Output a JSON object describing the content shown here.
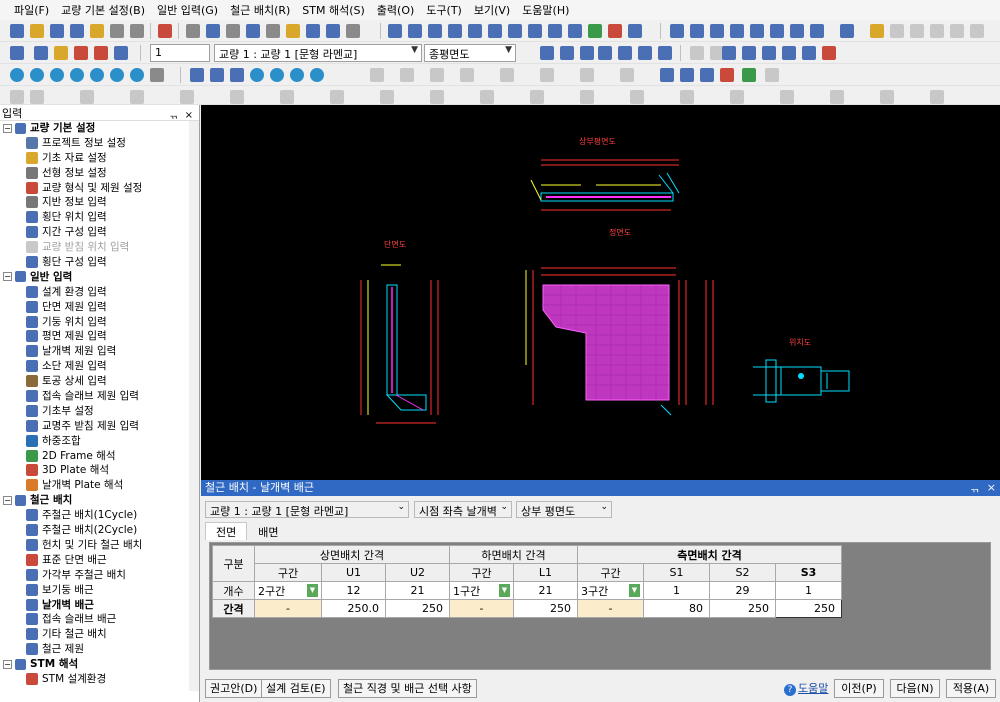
{
  "menu": [
    "파일(F)",
    "교량 기본 설정(B)",
    "일반 입력(G)",
    "철근 배치(R)",
    "STM 해석(S)",
    "출력(O)",
    "도구(T)",
    "보기(V)",
    "도움말(H)"
  ],
  "toolbar": {
    "number_field": "1",
    "bridge_combo": "교량 1 : 교량 1 [문형 라멘교]",
    "view_combo": "종평면도"
  },
  "panel": {
    "title": "입력",
    "pin": "ᆩ",
    "close": "×",
    "groups": [
      {
        "label": "교량 기본 설정",
        "items": [
          {
            "label": "프로젝트 정보 설정",
            "icon": "#5577aa"
          },
          {
            "label": "기초 자료 설정",
            "icon": "#d9a82b"
          },
          {
            "label": "선형 정보 설정",
            "icon": "#777777"
          },
          {
            "label": "교량 형식 및 제원 설정",
            "icon": "#c94a3a"
          },
          {
            "label": "지반 정보 입력",
            "icon": "#777777"
          },
          {
            "label": "횡단 위치 입력",
            "icon": "#4a6fb5"
          },
          {
            "label": "지간 구성 입력",
            "icon": "#4a6fb5"
          },
          {
            "label": "교량 받침 위치 입력",
            "icon": "#c8c8c8",
            "disabled": true
          },
          {
            "label": "횡단 구성 입력",
            "icon": "#4a6fb5"
          }
        ]
      },
      {
        "label": "일반 입력",
        "items": [
          {
            "label": "설계 환경 입력",
            "icon": "#4a6fb5"
          },
          {
            "label": "단면 제원 입력",
            "icon": "#4a6fb5"
          },
          {
            "label": "기둥 위치 입력",
            "icon": "#4a6fb5"
          },
          {
            "label": "평면 제원 입력",
            "icon": "#4a6fb5"
          },
          {
            "label": "날개벽 제원 입력",
            "icon": "#4a6fb5"
          },
          {
            "label": "소단 제원 입력",
            "icon": "#4a6fb5"
          },
          {
            "label": "토공 상세 입력",
            "icon": "#8a6a3a"
          },
          {
            "label": "접속 슬래브 제원 입력",
            "icon": "#4a6fb5"
          },
          {
            "label": "기초부 설정",
            "icon": "#4a6fb5"
          },
          {
            "label": "교명주 받침 제원 입력",
            "icon": "#4a6fb5"
          },
          {
            "label": "하중조합",
            "icon": "#2b6fb5"
          },
          {
            "label": "2D Frame 해석",
            "icon": "#3a9a4a"
          },
          {
            "label": "3D Plate 해석",
            "icon": "#c94a3a"
          },
          {
            "label": "날개벽 Plate 해석",
            "icon": "#d97a2b"
          }
        ]
      },
      {
        "label": "철근 배치",
        "items": [
          {
            "label": "주철근 배치(1Cycle)",
            "icon": "#4a6fb5"
          },
          {
            "label": "주철근 배치(2Cycle)",
            "icon": "#4a6fb5"
          },
          {
            "label": "헌치 및 기타 철근 배치",
            "icon": "#4a6fb5"
          },
          {
            "label": "표준 단면 배근",
            "icon": "#c94a3a"
          },
          {
            "label": "가각부 주철근 배치",
            "icon": "#4a6fb5"
          },
          {
            "label": "보기둥 배근",
            "icon": "#4a6fb5"
          },
          {
            "label": "날개벽 배근",
            "icon": "#4a6fb5",
            "bold": true
          },
          {
            "label": "접속 슬래브 배근",
            "icon": "#4a6fb5"
          },
          {
            "label": "기타 철근 배치",
            "icon": "#4a6fb5"
          },
          {
            "label": "철근 제원",
            "icon": "#4a6fb5"
          }
        ]
      },
      {
        "label": "STM 해석",
        "items": [
          {
            "label": "STM 설계환경",
            "icon": "#c94a3a"
          }
        ]
      }
    ]
  },
  "drawing": {
    "label_top": "상부평면도",
    "label_mid": "정면도",
    "label_left": "단면도",
    "label_right": "위치도"
  },
  "dialog": {
    "title": "철근 배치 - 날개벽 배근",
    "pin": "ᆩ",
    "close": "×",
    "bridge_combo": "교량 1 : 교량 1 [문형 라멘교]",
    "side_combo": "시점 좌측 날개벽",
    "view_combo": "상부 평면도",
    "tabs": [
      "전면",
      "배면"
    ],
    "grid": {
      "corner": "구분",
      "group_top": "상면배치 간격",
      "group_bottom": "하면배치 간격",
      "group_side": "측면배치 간격",
      "subheaders": {
        "top": [
          "구간",
          "U1",
          "U2"
        ],
        "bottom": [
          "구간",
          "L1"
        ],
        "side": [
          "구간",
          "S1",
          "S2",
          "S3"
        ]
      },
      "row_count": {
        "label": "개수",
        "top_zone": "2구간",
        "u1": "12",
        "u2": "21",
        "bottom_zone": "1구간",
        "l1": "21",
        "side_zone": "3구간",
        "s1": "1",
        "s2": "29",
        "s3": "1"
      },
      "row_spacing": {
        "label": "간격",
        "top_zone": "-",
        "u1": "250.0",
        "u2": "250",
        "bottom_zone": "-",
        "l1": "250",
        "side_zone": "-",
        "s1": "80",
        "s2": "250",
        "s3": "250"
      }
    },
    "buttons": {
      "recommend": "권고안(D)",
      "check": "설계 검토(E)",
      "rebar_options": "철근 직경 및 배근 선택 사항",
      "help": "도움말",
      "prev": "이전(P)",
      "next": "다음(N)",
      "apply": "적용(A)"
    }
  }
}
